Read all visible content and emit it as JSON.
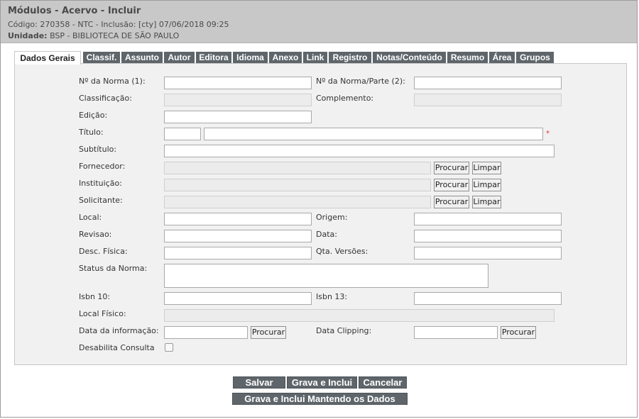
{
  "header": {
    "title": "Módulos - Acervo - Incluir",
    "code_line": "Código: 270358 - NTC - Inclusão: [cty] 07/06/2018 09:25",
    "unit_label": "Unidade:",
    "unit_value": "BSP - BIBLIOTECA DE SÃO PAULO"
  },
  "tabs": [
    {
      "label": "Dados Gerais",
      "active": true
    },
    {
      "label": "Classif."
    },
    {
      "label": "Assunto"
    },
    {
      "label": "Autor"
    },
    {
      "label": "Editora"
    },
    {
      "label": "Idioma"
    },
    {
      "label": "Anexo"
    },
    {
      "label": "Link"
    },
    {
      "label": "Registro"
    },
    {
      "label": "Notas/Conteúdo"
    },
    {
      "label": "Resumo"
    },
    {
      "label": "Área"
    },
    {
      "label": "Grupos"
    }
  ],
  "form": {
    "norma1": {
      "label": "Nº da Norma (1):",
      "value": ""
    },
    "norma2": {
      "label": "Nº da Norma/Parte (2):",
      "value": ""
    },
    "classificacao": {
      "label": "Classificação:",
      "value": ""
    },
    "complemento": {
      "label": "Complemento:",
      "value": ""
    },
    "edicao": {
      "label": "Edição:",
      "value": ""
    },
    "titulo": {
      "label": "Título:",
      "prefix_value": "",
      "value": "",
      "required_mark": "*"
    },
    "subtitulo": {
      "label": "Subtítulo:",
      "value": ""
    },
    "fornecedor": {
      "label": "Fornecedor:",
      "value": ""
    },
    "instituicao": {
      "label": "Instituição:",
      "value": ""
    },
    "solicitante": {
      "label": "Solicitante:",
      "value": ""
    },
    "local": {
      "label": "Local:",
      "value": ""
    },
    "origem": {
      "label": "Origem:",
      "value": ""
    },
    "revisao": {
      "label": "Revisao:",
      "value": ""
    },
    "data": {
      "label": "Data:",
      "value": ""
    },
    "desc_fisica": {
      "label": "Desc. Física:",
      "value": ""
    },
    "qta_versoes": {
      "label": "Qta. Versões:",
      "value": ""
    },
    "status_norma": {
      "label": "Status da Norma:",
      "value": ""
    },
    "isbn10": {
      "label": "Isbn 10:",
      "value": ""
    },
    "isbn13": {
      "label": "Isbn 13:",
      "value": ""
    },
    "local_fisico": {
      "label": "Local Físico:",
      "value": ""
    },
    "data_informacao": {
      "label": "Data da informação:",
      "value": ""
    },
    "data_clipping": {
      "label": "Data Clipping:",
      "value": ""
    },
    "desabilita_consulta": {
      "label": "Desabilita Consulta",
      "checked": false
    },
    "procurar_label": "Procurar",
    "limpar_label": "Limpar"
  },
  "actions": {
    "salvar": "Salvar",
    "grava_inclui": "Grava e Inclui",
    "cancelar": "Cancelar",
    "grava_inclui_mantendo": "Grava e Inclui Mantendo os Dados"
  }
}
